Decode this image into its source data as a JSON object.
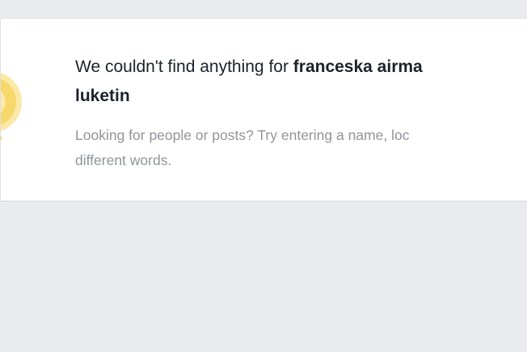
{
  "colors": {
    "page_background": "#e9ebee",
    "card_background": "#ffffff",
    "heading_text": "#1d2129",
    "hint_text": "#90949c",
    "illustration_primary": "#f7d86a",
    "illustration_secondary": "#fbe9a8"
  },
  "empty_state": {
    "icon": "search-magnifier-icon",
    "heading_prefix": "We couldn't find anything for ",
    "query_line1": "franceska airma",
    "query_line2": "luketin",
    "hint_line1": "Looking for people or posts? Try entering a name, loc",
    "hint_line2": "different words."
  }
}
